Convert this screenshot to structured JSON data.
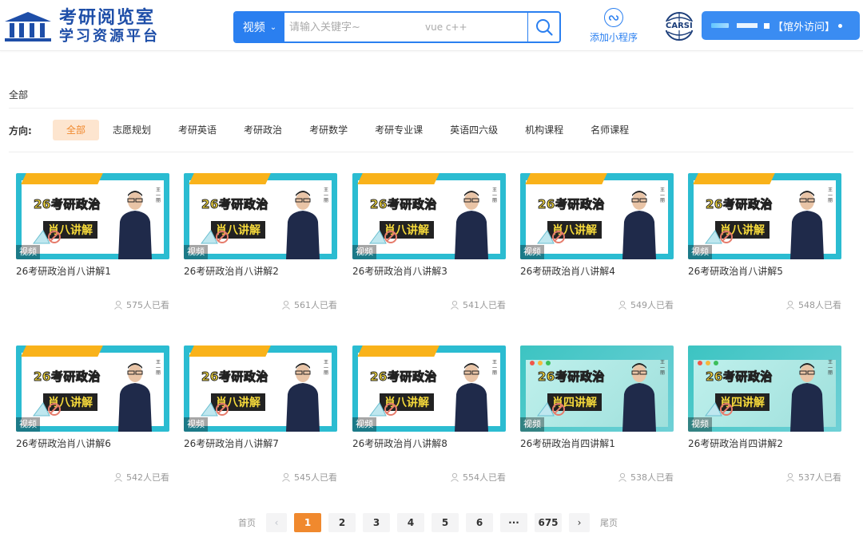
{
  "header": {
    "logo_line1": "考研阅览室",
    "logo_line2": "学习资源平台",
    "search_type": "视频",
    "search_placeholder": "请输入关键字~",
    "search_hint": "vue c++",
    "mini_program_label": "添加小程序",
    "carsi_label": "CARSI",
    "visit_label": "【馆外访问】"
  },
  "breadcrumb": "全部",
  "filter": {
    "label": "方向:",
    "items": [
      "全部",
      "志愿规划",
      "考研英语",
      "考研政治",
      "考研数学",
      "考研专业课",
      "英语四六级",
      "机构课程",
      "名师课程"
    ],
    "active_index": 0
  },
  "thumb": {
    "tag": "视频",
    "teacher_name": "王一丽",
    "line1": "26考研政治",
    "line2_v1": "肖八讲解",
    "line2_v2": "肖四讲解"
  },
  "cards": [
    {
      "title": "26考研政治肖八讲解1",
      "views": "575人已看",
      "style": "v1"
    },
    {
      "title": "26考研政治肖八讲解2",
      "views": "561人已看",
      "style": "v1"
    },
    {
      "title": "26考研政治肖八讲解3",
      "views": "541人已看",
      "style": "v1"
    },
    {
      "title": "26考研政治肖八讲解4",
      "views": "549人已看",
      "style": "v1"
    },
    {
      "title": "26考研政治肖八讲解5",
      "views": "548人已看",
      "style": "v1"
    },
    {
      "title": "26考研政治肖八讲解6",
      "views": "542人已看",
      "style": "v1"
    },
    {
      "title": "26考研政治肖八讲解7",
      "views": "545人已看",
      "style": "v1"
    },
    {
      "title": "26考研政治肖八讲解8",
      "views": "554人已看",
      "style": "v1"
    },
    {
      "title": "26考研政治肖四讲解1",
      "views": "538人已看",
      "style": "v2"
    },
    {
      "title": "26考研政治肖四讲解2",
      "views": "537人已看",
      "style": "v2"
    }
  ],
  "pagination": {
    "first": "首页",
    "last": "尾页",
    "pages": [
      "1",
      "2",
      "3",
      "4",
      "5",
      "6",
      "···",
      "675"
    ],
    "current": "1"
  },
  "colors": {
    "brand_blue": "#2a7ff0",
    "active_orange": "#f0892e",
    "thumb_frame": "#2bbcd1",
    "ribbon_yellow": "#f9b21a"
  }
}
